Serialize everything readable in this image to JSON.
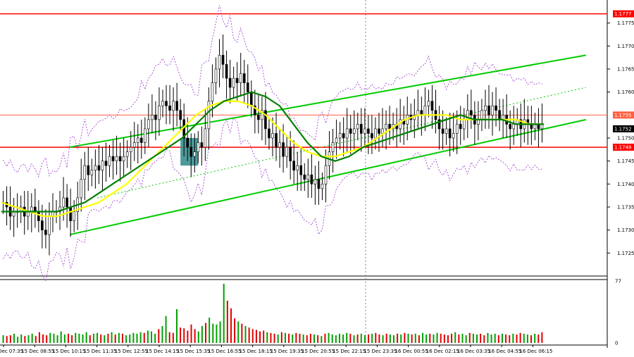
{
  "chart_data": {
    "type": "candlestick",
    "colors": {
      "candle": "#000000",
      "level_line": "#ff0000",
      "channel": "#00cc00",
      "ma_fast": "#008000",
      "ma_slow": "#ffff00",
      "envelope": "#9a32cd",
      "signal_box": "#3b8f8f",
      "vol_up": "#00a000",
      "vol_down": "#e00000",
      "tag_red": "#ff0000",
      "tag_orange": "#ff6040",
      "tag_black": "#000000"
    },
    "price_axis": {
      "ylim": [
        1.172,
        1.178
      ],
      "ticks": [
        "1.1775",
        "1.1770",
        "1.1765",
        "1.1760",
        "1.1750",
        "1.1745",
        "1.1740",
        "1.1735",
        "1.1730",
        "1.1725"
      ]
    },
    "levels": [
      {
        "price": 1.1777,
        "label": "1.1777",
        "color": "red",
        "width": 1.5
      },
      {
        "price": 1.1755,
        "label": "1.1755",
        "color": "orange",
        "width": 1
      },
      {
        "price": 1.1748,
        "label": "1.1748",
        "color": "red",
        "width": 1.5
      }
    ],
    "current_price": {
      "value": 1.1752,
      "label": "1.1752"
    },
    "time_labels": [
      "15 Dec 07:35",
      "15 Dec 08:55",
      "15 Dec 10:15",
      "15 Dec 11:35",
      "15 Dec 12:55",
      "15 Dec 14:15",
      "15 Dec 15:35",
      "15 Dec 16:55",
      "15 Dec 18:15",
      "15 Dec 19:35",
      "15 Dec 20:55",
      "15 Dec 22:15",
      "15 Dec 23:35",
      "16 Dec 00:55",
      "16 Dec 02:15",
      "16 Dec 03:35",
      "16 Dec 04:55",
      "16 Dec 06:15"
    ],
    "close_series": [
      1.1736,
      1.1735,
      1.1733,
      1.1734,
      1.1734,
      1.1735,
      1.1733,
      1.1734,
      1.1735,
      1.1734,
      1.1732,
      1.173,
      1.1729,
      1.1733,
      1.1734,
      1.1734,
      1.1735,
      1.1737,
      1.1735,
      1.1732,
      1.1734,
      1.1737,
      1.1741,
      1.1744,
      1.1742,
      1.1743,
      1.1744,
      1.1743,
      1.1745,
      1.1744,
      1.1746,
      1.1745,
      1.1746,
      1.1745,
      1.1746,
      1.1747,
      1.1748,
      1.1749,
      1.175,
      1.1749,
      1.1752,
      1.1754,
      1.1755,
      1.1754,
      1.1757,
      1.1758,
      1.1757,
      1.1756,
      1.1758,
      1.1756,
      1.1754,
      1.175,
      1.1748,
      1.1746,
      1.1747,
      1.1749,
      1.1748,
      1.1752,
      1.1758,
      1.1762,
      1.1765,
      1.1768,
      1.1766,
      1.1763,
      1.1761,
      1.1763,
      1.1762,
      1.1764,
      1.1762,
      1.176,
      1.1757,
      1.1755,
      1.1754,
      1.1756,
      1.1752,
      1.175,
      1.1751,
      1.1748,
      1.1749,
      1.1746,
      1.1748,
      1.1745,
      1.1743,
      1.1744,
      1.1742,
      1.1741,
      1.1742,
      1.174,
      1.1741,
      1.1739,
      1.174,
      1.1744,
      1.1747,
      1.1749,
      1.175,
      1.1751,
      1.175,
      1.1752,
      1.1751,
      1.1752,
      1.1753,
      1.1751,
      1.1752,
      1.1751,
      1.175,
      1.1752,
      1.1751,
      1.1752,
      1.1753,
      1.1752,
      1.1753,
      1.1752,
      1.1754,
      1.1753,
      1.1755,
      1.1754,
      1.1755,
      1.1756,
      1.1755,
      1.1757,
      1.1758,
      1.1756,
      1.1754,
      1.1752,
      1.1751,
      1.1752,
      1.175,
      1.1751,
      1.1753,
      1.1752,
      1.1754,
      1.1756,
      1.1755,
      1.1753,
      1.1754,
      1.1756,
      1.1757,
      1.1755,
      1.1757,
      1.1756,
      1.1754,
      1.1755,
      1.1753,
      1.1752,
      1.1753,
      1.1754,
      1.1752,
      1.1754,
      1.1753,
      1.1752,
      1.1753,
      1.1752,
      1.1753
    ],
    "ma_fast_series": [
      1.1734,
      1.1734,
      1.1734,
      1.1734,
      1.1734,
      1.1735,
      1.1736,
      1.1738,
      1.174,
      1.1742,
      1.1744,
      1.1746,
      1.1748,
      1.175,
      1.1753,
      1.1756,
      1.1758,
      1.1759,
      1.176,
      1.1759,
      1.1757,
      1.1753,
      1.1749,
      1.1746,
      1.1745,
      1.1746,
      1.1748,
      1.1749,
      1.175,
      1.1751,
      1.1752,
      1.1753,
      1.1754,
      1.1755,
      1.1754,
      1.1754,
      1.1754,
      1.1753,
      1.1753,
      1.1753
    ],
    "ma_slow_series": [
      1.1736,
      1.1735,
      1.1734,
      1.1733,
      1.1733,
      1.1734,
      1.1735,
      1.1736,
      1.1738,
      1.174,
      1.1743,
      1.1746,
      1.1749,
      1.1752,
      1.1755,
      1.1757,
      1.1758,
      1.1758,
      1.1757,
      1.1755,
      1.1752,
      1.1749,
      1.1747,
      1.1746,
      1.1746,
      1.1747,
      1.1748,
      1.175,
      1.1752,
      1.1754,
      1.1755,
      1.1755,
      1.1755,
      1.1754,
      1.1754,
      1.1754,
      1.1754,
      1.1754,
      1.1753,
      1.1753
    ],
    "channel": {
      "upper": [
        [
          0.115,
          1.1748
        ],
        [
          0.965,
          1.1768
        ]
      ],
      "lower": [
        [
          0.115,
          1.1729
        ],
        [
          0.965,
          1.1754
        ]
      ],
      "mid_dotted": [
        [
          0.16,
          1.1737
        ],
        [
          0.965,
          1.1761
        ]
      ]
    },
    "signal_box": {
      "index_from": 50,
      "index_to": 55,
      "price_low": 1.1744,
      "price_high": 1.175
    },
    "volume_axis": {
      "ymax": 77,
      "ticks": [
        "77",
        "0"
      ]
    },
    "volume_series": [
      10,
      9,
      10,
      12,
      8,
      11,
      9,
      10,
      12,
      9,
      14,
      11,
      10,
      13,
      12,
      10,
      15,
      11,
      12,
      10,
      13,
      12,
      11,
      14,
      10,
      12,
      13,
      11,
      10,
      12,
      14,
      11,
      13,
      12,
      10,
      11,
      13,
      12,
      14,
      13,
      16,
      15,
      12,
      18,
      22,
      35,
      14,
      13,
      44,
      20,
      19,
      16,
      24,
      18,
      15,
      22,
      26,
      33,
      25,
      24,
      28,
      77,
      55,
      45,
      32,
      28,
      25,
      22,
      20,
      18,
      17,
      15,
      16,
      14,
      13,
      12,
      11,
      14,
      13,
      12,
      11,
      13,
      12,
      11,
      10,
      12,
      11,
      10,
      9,
      12,
      13,
      11,
      10,
      12,
      11,
      13,
      12,
      10,
      11,
      12,
      10,
      11,
      12,
      13,
      11,
      10,
      12,
      11,
      10,
      12,
      11,
      13,
      12,
      11,
      12,
      10,
      13,
      11,
      12,
      11,
      13,
      12,
      11,
      10,
      12,
      14,
      11,
      12,
      10,
      13,
      12,
      11,
      12,
      10,
      13,
      11,
      12,
      10,
      12,
      11,
      10,
      12,
      11,
      13,
      12,
      11,
      10,
      12,
      11,
      14
    ]
  }
}
